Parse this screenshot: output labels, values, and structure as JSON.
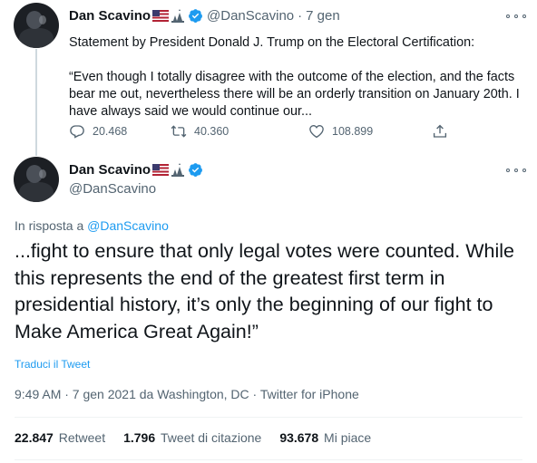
{
  "tweet1": {
    "name": "Dan Scavino",
    "handle": "@DanScavino",
    "dot": "·",
    "time": "7 gen",
    "text_line1": "Statement by President Donald J. Trump on the Electoral Certification:",
    "text_quote": "“Even though I totally disagree with the outcome of the election, and the facts bear me out, nevertheless there will be an orderly transition on January 20th. I have always said we would continue our...",
    "replies": "20.468",
    "retweets": "40.360",
    "likes": "108.899"
  },
  "tweet2": {
    "name": "Dan Scavino",
    "handle": "@DanScavino",
    "reply_prefix": "In risposta a",
    "reply_handle": "@DanScavino",
    "text": "...fight to ensure that only legal votes were counted. While this represents the end of the greatest first term in presidential history, it’s only the beginning of our fight to Make America Great Again!”",
    "translate": "Traduci il Tweet",
    "meta": "9:49 AM · 7 gen 2021 da Washington, DC · Twitter for iPhone",
    "stats": [
      {
        "count": "22.847",
        "label": "Retweet"
      },
      {
        "count": "1.796",
        "label": "Tweet di citazione"
      },
      {
        "count": "93.678",
        "label": "Mi piace"
      }
    ]
  },
  "colors": {
    "accent": "#1d9bf0",
    "secondary_text": "#536471",
    "verified": "#1d9bf0"
  },
  "icons": [
    "reply-icon",
    "retweet-icon",
    "like-icon",
    "share-icon",
    "verified-badge-icon",
    "us-flag-icon",
    "more-options-icon"
  ]
}
